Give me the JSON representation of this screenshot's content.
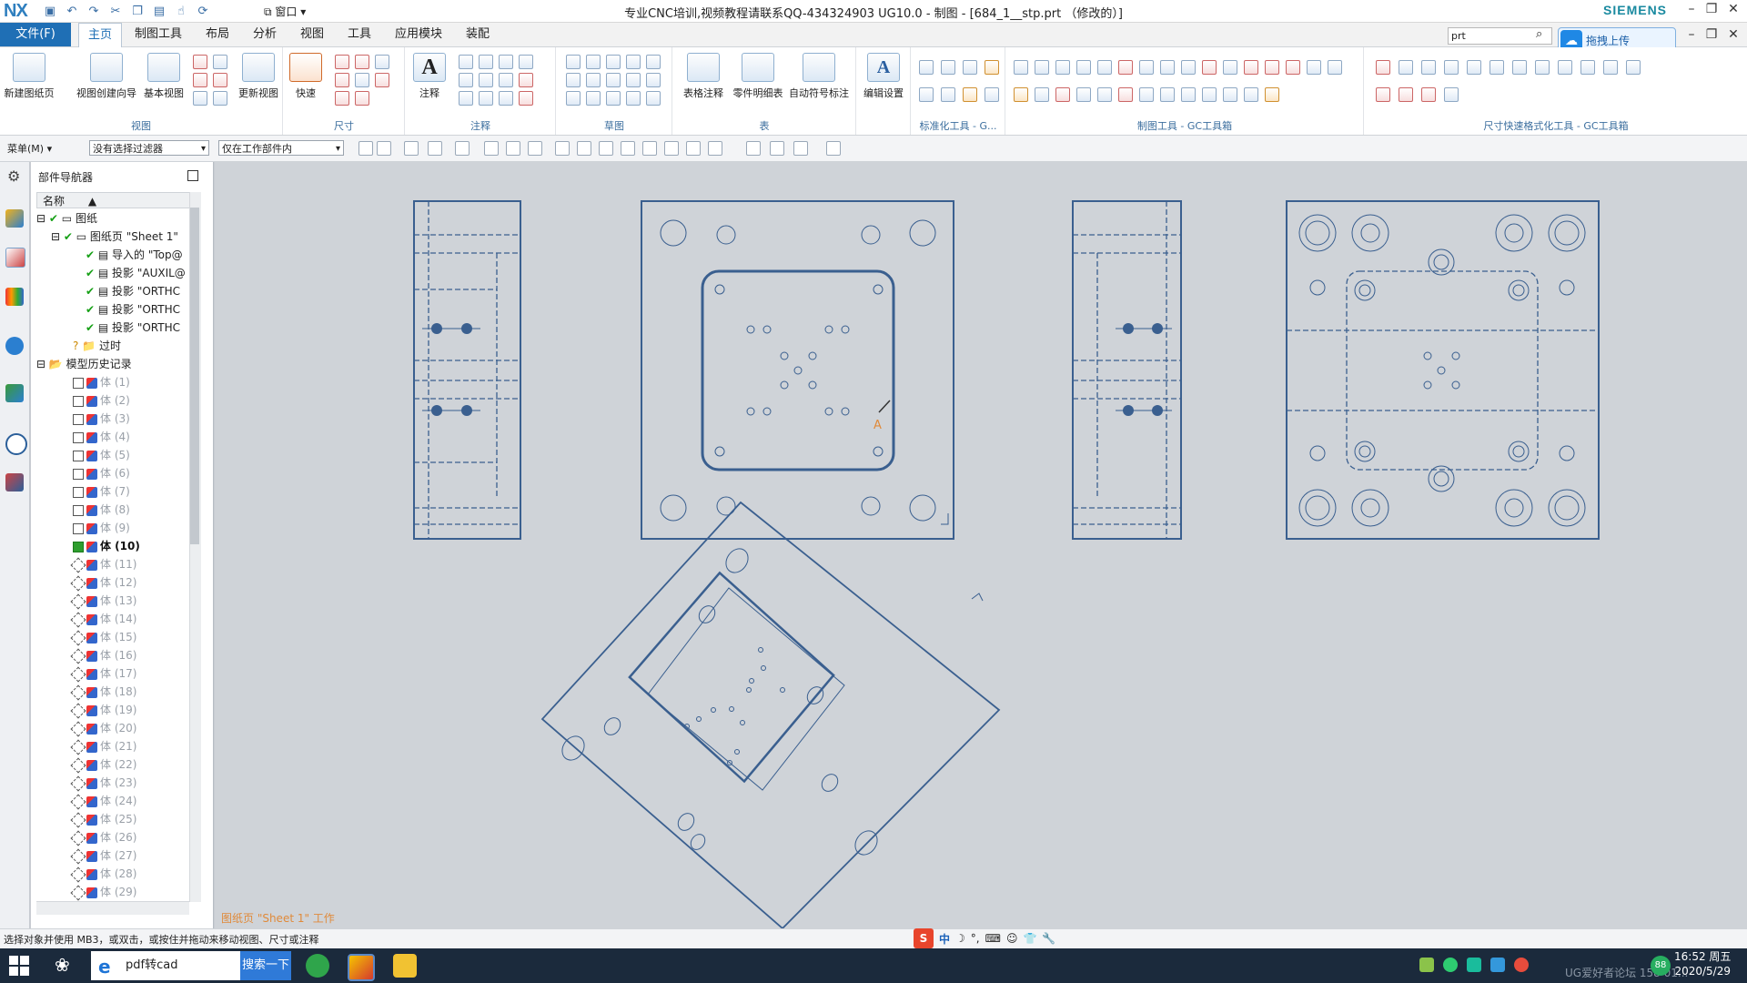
{
  "titlebar": {
    "logo": "NX",
    "window_menu": "窗口",
    "title": "专业CNC培训,视频教程请联系QQ-434324903 UG10.0 - 制图 - [684_1__stp.prt （修改的）]",
    "brand": "SIEMENS"
  },
  "menu": {
    "file": "文件(F)",
    "tabs": [
      "主页",
      "制图工具",
      "布局",
      "分析",
      "视图",
      "工具",
      "应用模块",
      "装配"
    ],
    "search_value": "prt",
    "upload": "拖拽上传"
  },
  "ribbon": {
    "groups": {
      "view": "视图",
      "dimension": "尺寸",
      "annotation": "注释",
      "sketch": "草图",
      "table": "表",
      "std_tools": "标准化工具 - G...",
      "drafting_tools": "制图工具 - GC工具箱",
      "dim_format_tools": "尺寸快速格式化工具 - GC工具箱"
    },
    "buttons": {
      "new_sheet": "新建图纸页",
      "view_wizard": "视图创建向导",
      "base_view": "基本视图",
      "update_view": "更新视图",
      "quick": "快速",
      "note": "注释",
      "table_note": "表格注释",
      "parts_list": "零件明细表",
      "auto_balloon": "自动符号标注",
      "edit_settings": "编辑设置"
    }
  },
  "selection_bar": {
    "menu": "菜单(M)",
    "filter": "没有选择过滤器",
    "scope": "仅在工作部件内"
  },
  "navigator": {
    "title": "部件导航器",
    "column": "名称",
    "drawing": "图纸",
    "sheet": "图纸页 \"Sheet 1\"",
    "children": [
      "导入的 \"Top@",
      "投影 \"AUXIL@",
      "投影 \"ORTHC",
      "投影 \"ORTHC",
      "投影 \"ORTHC"
    ],
    "outdated": "过时",
    "history": "模型历史记录",
    "bodies": [
      "体 (1)",
      "体 (2)",
      "体 (3)",
      "体 (4)",
      "体 (5)",
      "体 (6)",
      "体 (7)",
      "体 (8)",
      "体 (9)",
      "体 (10)",
      "体 (11)",
      "体 (12)",
      "体 (13)",
      "体 (14)",
      "体 (15)",
      "体 (16)",
      "体 (17)",
      "体 (18)",
      "体 (19)",
      "体 (20)",
      "体 (21)",
      "体 (22)",
      "体 (23)",
      "体 (24)",
      "体 (25)",
      "体 (26)",
      "体 (27)",
      "体 (28)",
      "体 (29)"
    ]
  },
  "canvas": {
    "sheet_status": "图纸页 \"Sheet 1\" 工作",
    "annotation_letter": "A"
  },
  "status": {
    "text": "选择对象并使用 MB3，或双击，或按住并拖动来移动视图、尺寸或注释"
  },
  "taskbar": {
    "search_value": "pdf转cad",
    "search_button": "搜索一下",
    "time": "16:52 周五",
    "date": "2020/5/29",
    "watermark": "UG爱好者论坛 158 01..."
  },
  "colors": {
    "drawing_line": "#3a5f8f",
    "accent": "#1f6fb5",
    "checkmark": "#16a016",
    "annotation": "#e08a3a"
  }
}
